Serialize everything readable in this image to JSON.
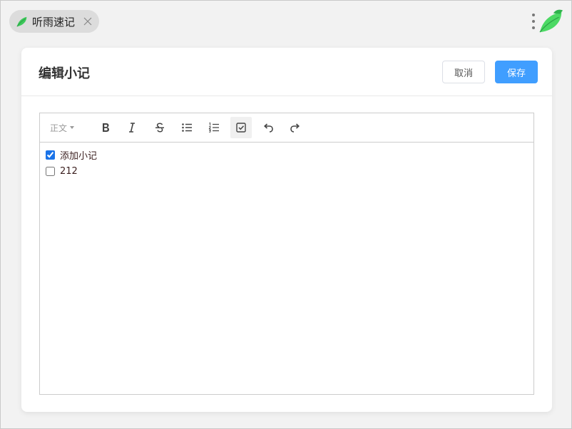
{
  "app": {
    "tab_title": "听雨速记"
  },
  "dialog": {
    "title": "编辑小记",
    "cancel_label": "取消",
    "save_label": "保存"
  },
  "toolbar": {
    "heading_label": "正文",
    "tools": [
      "bold-icon",
      "italic-icon",
      "strikethrough-icon",
      "bullet-list-icon",
      "numbered-list-icon",
      "checklist-icon",
      "undo-icon",
      "redo-icon"
    ],
    "active_tool": "checklist-icon"
  },
  "todos": [
    {
      "text": "添加小记",
      "checked": true
    },
    {
      "text": "212",
      "checked": false
    }
  ],
  "colors": {
    "accent": "#409eff",
    "brand_green": "#4cd964"
  }
}
